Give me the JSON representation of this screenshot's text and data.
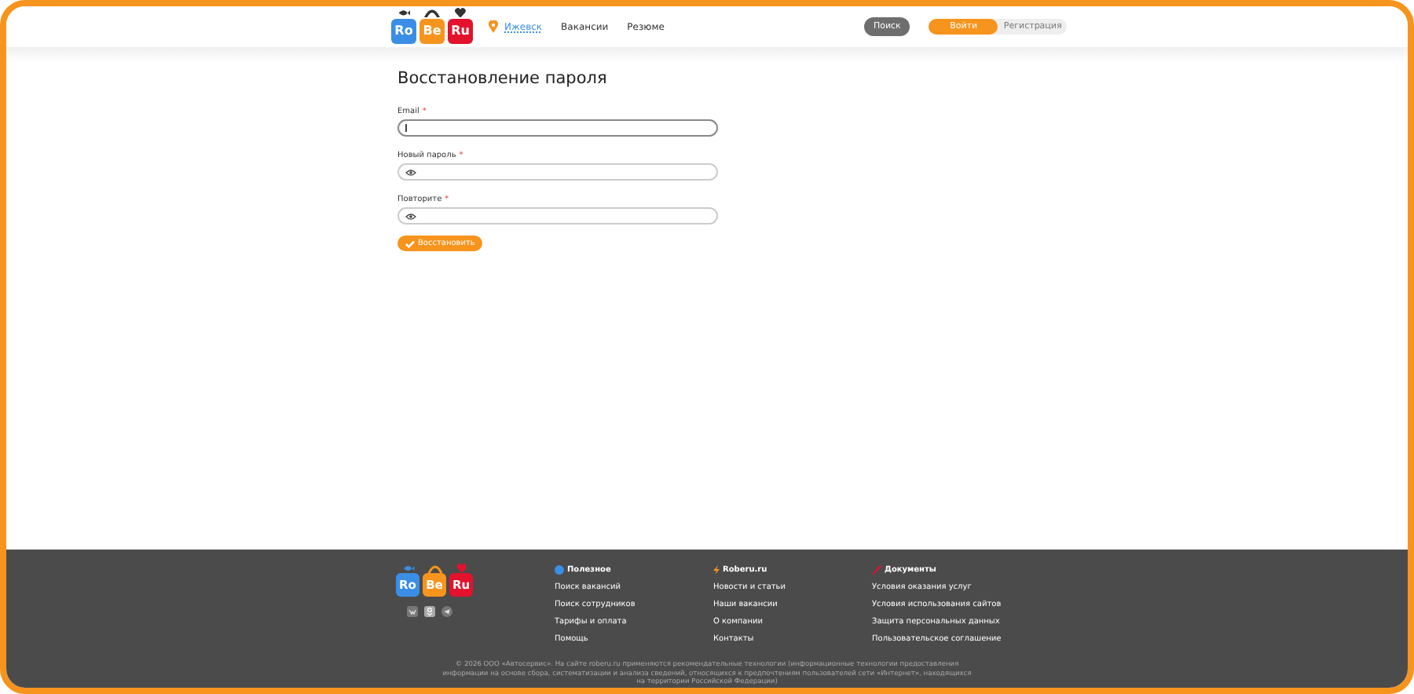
{
  "header": {
    "logo": [
      "Ro",
      "Be",
      "Ru"
    ],
    "city": "Ижевск",
    "nav": [
      "Вакансии",
      "Резюме"
    ],
    "search_button": "Поиск",
    "auth_tabs": [
      {
        "label": "Войти",
        "selected": true
      },
      {
        "label": "Регистрация",
        "selected": false
      }
    ]
  },
  "form": {
    "title": "Восстановление пароля",
    "fields": [
      {
        "label": "Email",
        "required_mark": "*",
        "kind": "text",
        "focused": true
      },
      {
        "label": "Новый пароль",
        "required_mark": "*",
        "kind": "password",
        "focused": false
      },
      {
        "label": "Повторите",
        "required_mark": "*",
        "kind": "password",
        "focused": false
      }
    ],
    "submit": "Восстановить"
  },
  "footer": {
    "logo": [
      "Ro",
      "Be",
      "Ru"
    ],
    "columns": [
      {
        "title": "Полезное",
        "kind": "info",
        "links": [
          "Поиск вакансий",
          "Поиск сотрудников",
          "Тарифы и оплата",
          "Помощь"
        ]
      },
      {
        "title": "Roberu.ru",
        "kind": "brand",
        "links": [
          "Новости и статьи",
          "Наши вакансии",
          "О компании",
          "Контакты"
        ]
      },
      {
        "title": "Документы",
        "kind": "docs",
        "links": [
          "Условия оказания услуг",
          "Условия использования сайтов",
          "Защита персональных данных",
          "Пользовательское соглашение"
        ]
      }
    ],
    "legal": "© 2026 ООО «Автосервис». На сайте roberu.ru применяются рекомендательные технологии (информационные технологии предоставления информации на основе сбора, систематизации и анализа сведений, относящихся к предпочтениям пользователей сети «Интернет», находящихся на территории Российской Федерации)"
  }
}
